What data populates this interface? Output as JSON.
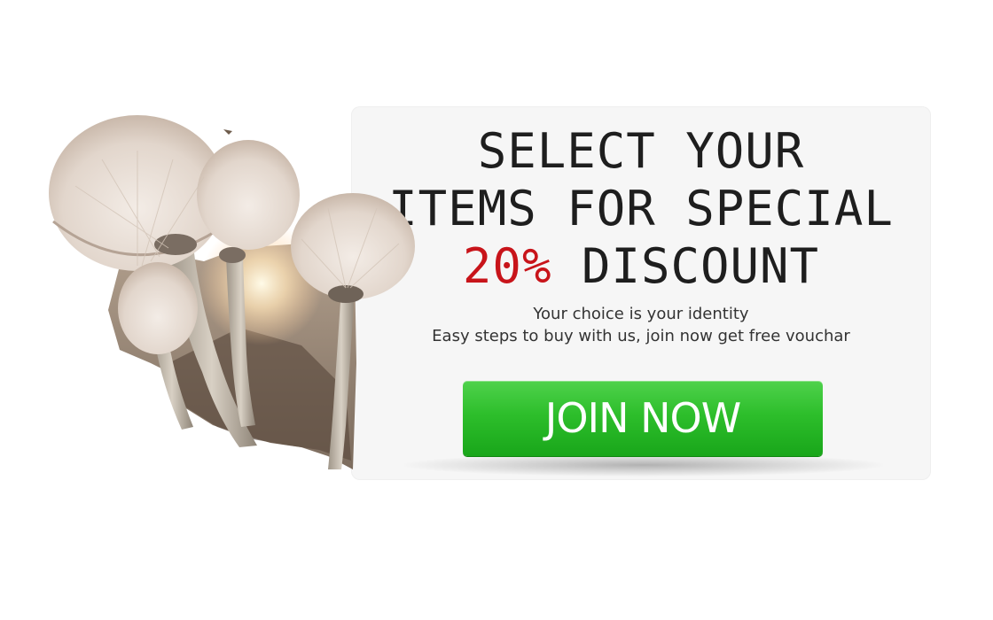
{
  "promo": {
    "headline_line1": "SELECT YOUR",
    "headline_line2": "ITEMS FOR SPECIAL",
    "headline_discount": "20%",
    "headline_line3_rest": " DISCOUNT",
    "subtext_line1": "Your choice is your identity",
    "subtext_line2": "Easy steps to buy with us, join now get free vouchar",
    "cta_label": "JOIN NOW"
  },
  "colors": {
    "accent_red": "#c8141a",
    "cta_green": "#2dbe2b",
    "card_background": "#f6f6f6",
    "headline_text": "#1e1e1e"
  },
  "image": {
    "subject": "mushrooms-photo"
  }
}
